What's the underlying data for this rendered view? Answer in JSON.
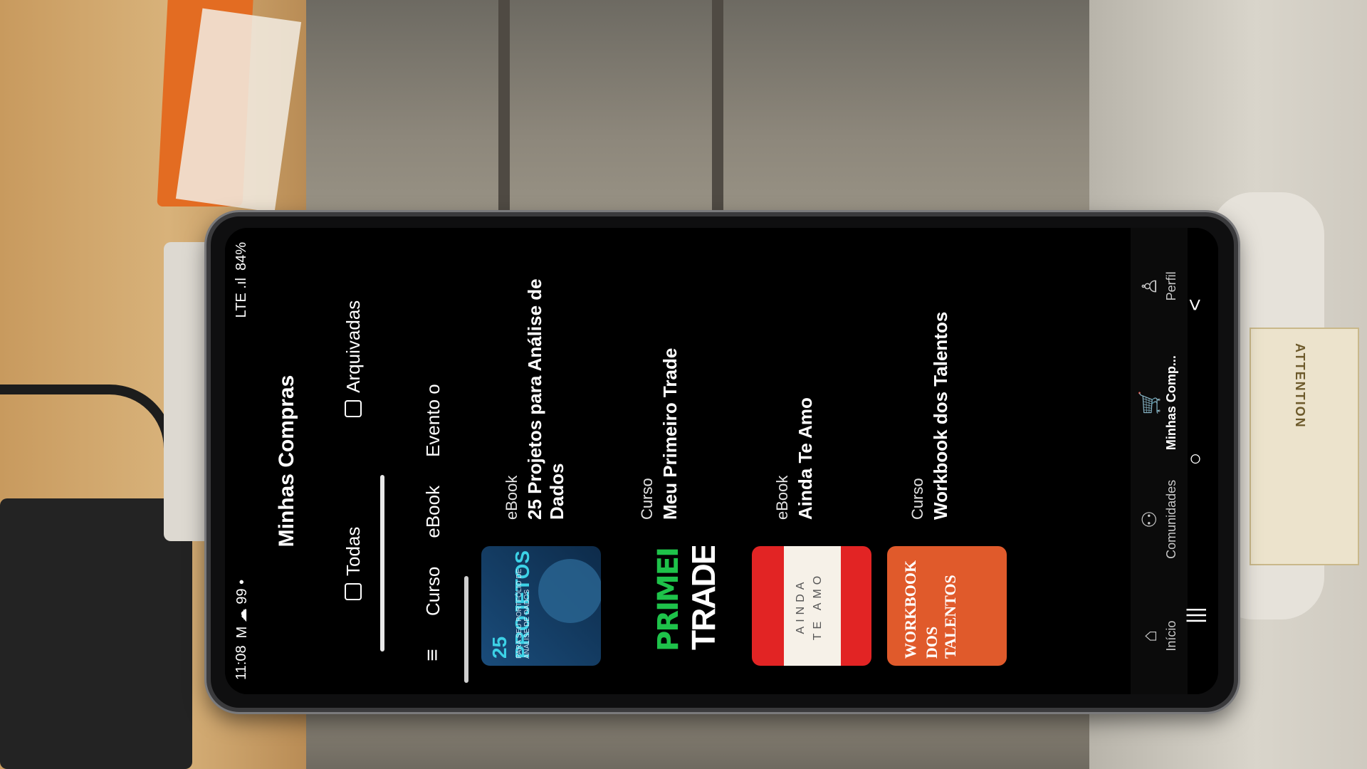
{
  "status_bar": {
    "time": "11:08",
    "left_icons": "M ☁ 99 •",
    "battery": "84%",
    "signal": "LTE .ıl"
  },
  "header": {
    "title": "Minhas Compras"
  },
  "segments": [
    {
      "label": "Todas",
      "active": true,
      "icon": "tag-icon"
    },
    {
      "label": "Arquivadas",
      "active": false,
      "icon": "archive-icon"
    }
  ],
  "filters": [
    "Curso",
    "eBook",
    "Evento o"
  ],
  "items": [
    {
      "kind": "eBook",
      "title": "25 Projetos para Análise de Dados",
      "thumb_line1": "25 PROJETOS",
      "thumb_line2": "PARA SEU PORTFÓLIO DE ANÁLISE DE DADOS"
    },
    {
      "kind": "Curso",
      "title": "Meu Primeiro Trade",
      "thumb_line1": "PRIMEIRO",
      "thumb_line2": "TRADE"
    },
    {
      "kind": "eBook",
      "title": "Ainda Te Amo",
      "thumb_line1": "AINDA",
      "thumb_line2": "TE AMO"
    },
    {
      "kind": "Curso",
      "title": "Workbook dos Talentos",
      "thumb_line1": "WORKBOOK",
      "thumb_line2": "DOS TALENTOS"
    }
  ],
  "bottom_nav": [
    {
      "label": "Início",
      "icon": "home-icon",
      "active": false
    },
    {
      "label": "Comunidades",
      "icon": "community-icon",
      "active": false
    },
    {
      "label": "Minhas Comp...",
      "icon": "cart-icon",
      "active": true
    },
    {
      "label": "Perfil",
      "icon": "profile-icon",
      "active": false
    }
  ],
  "system_nav": {
    "recents": "|||",
    "home": "○",
    "back": "<"
  },
  "background_label": "ATTENTION"
}
